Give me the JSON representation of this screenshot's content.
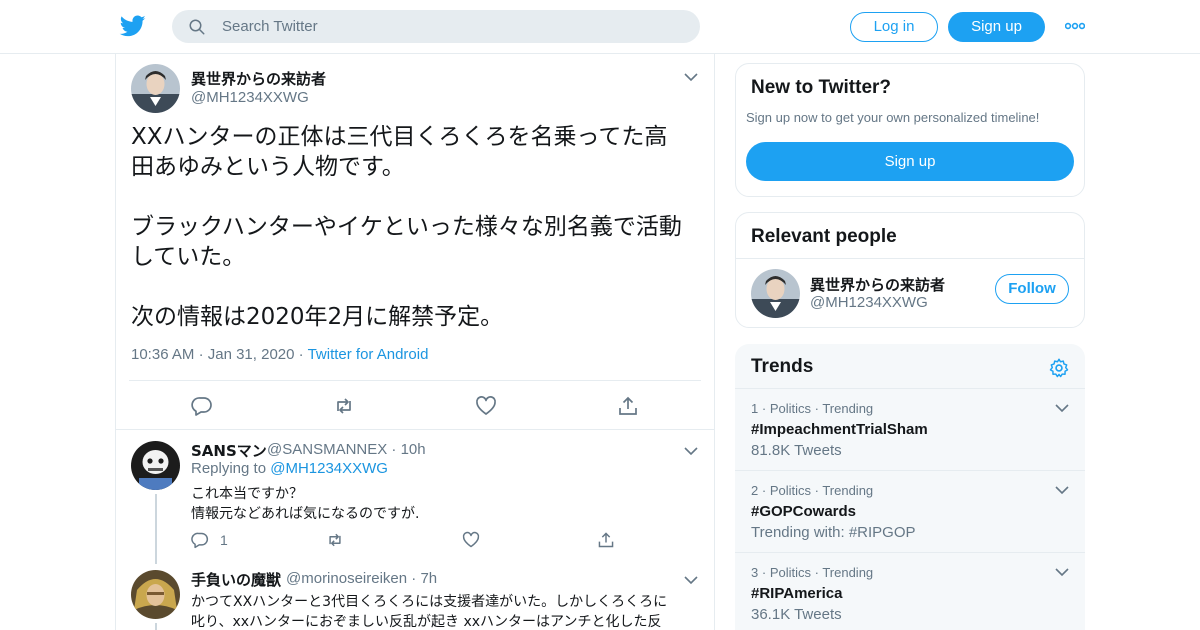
{
  "header": {
    "search_placeholder": "Search Twitter",
    "login_label": "Log in",
    "signup_label": "Sign up",
    "accent_color": "#1da1f2"
  },
  "tweet": {
    "display_name": "異世界からの来訪者",
    "handle": "@MH1234XXWG",
    "text": "XXハンターの正体は三代目くろくろを名乗ってた高\n田あゆみという人物です。\n\nブラックハンターやイケといった様々な別名義で活動\nしていた。\n\n次の情報は2020年2月に解禁予定。",
    "time": "10:36 AM",
    "date": "Jan 31, 2020",
    "source": "Twitter for Android",
    "separator": "·"
  },
  "replies": [
    {
      "display_name": "SANSマン",
      "handle": "@SANSMANNEX",
      "age": "10h",
      "replying_prefix": "Replying to",
      "replying_to": "@MH1234XXWG",
      "lines": [
        "これ本当ですか？",
        "情報元などあれば気になるのですが."
      ],
      "reply_count": "1"
    },
    {
      "display_name": "手負いの魔獣",
      "handle": "@morinoseireiken",
      "age": "7h",
      "lines": [
        "かつてXXハンターと3代目くろくろには支援者達がいた。しかしくろくろに",
        "叱り、xxハンターにおぞましい反乱が起き xxハンターはアンチと化した反"
      ]
    }
  ],
  "sidebar": {
    "new_card": {
      "title": "New to Twitter?",
      "subtitle": "Sign up now to get your own personalized timeline!",
      "signup_label": "Sign up"
    },
    "relevant": {
      "title": "Relevant people",
      "display_name": "異世界からの来訪者",
      "handle": "@MH1234XXWG",
      "follow_label": "Follow"
    },
    "trends": {
      "title": "Trends",
      "items": [
        {
          "rank": "1",
          "category": "Politics · Trending",
          "name": "#ImpeachmentTrialSham",
          "detail": "81.8K Tweets"
        },
        {
          "rank": "2",
          "category": "Politics · Trending",
          "name": "#GOPCowards",
          "detail": "Trending with: #RIPGOP"
        },
        {
          "rank": "3",
          "category": "Politics · Trending",
          "name": "#RIPAmerica",
          "detail": "36.1K Tweets"
        }
      ]
    }
  }
}
